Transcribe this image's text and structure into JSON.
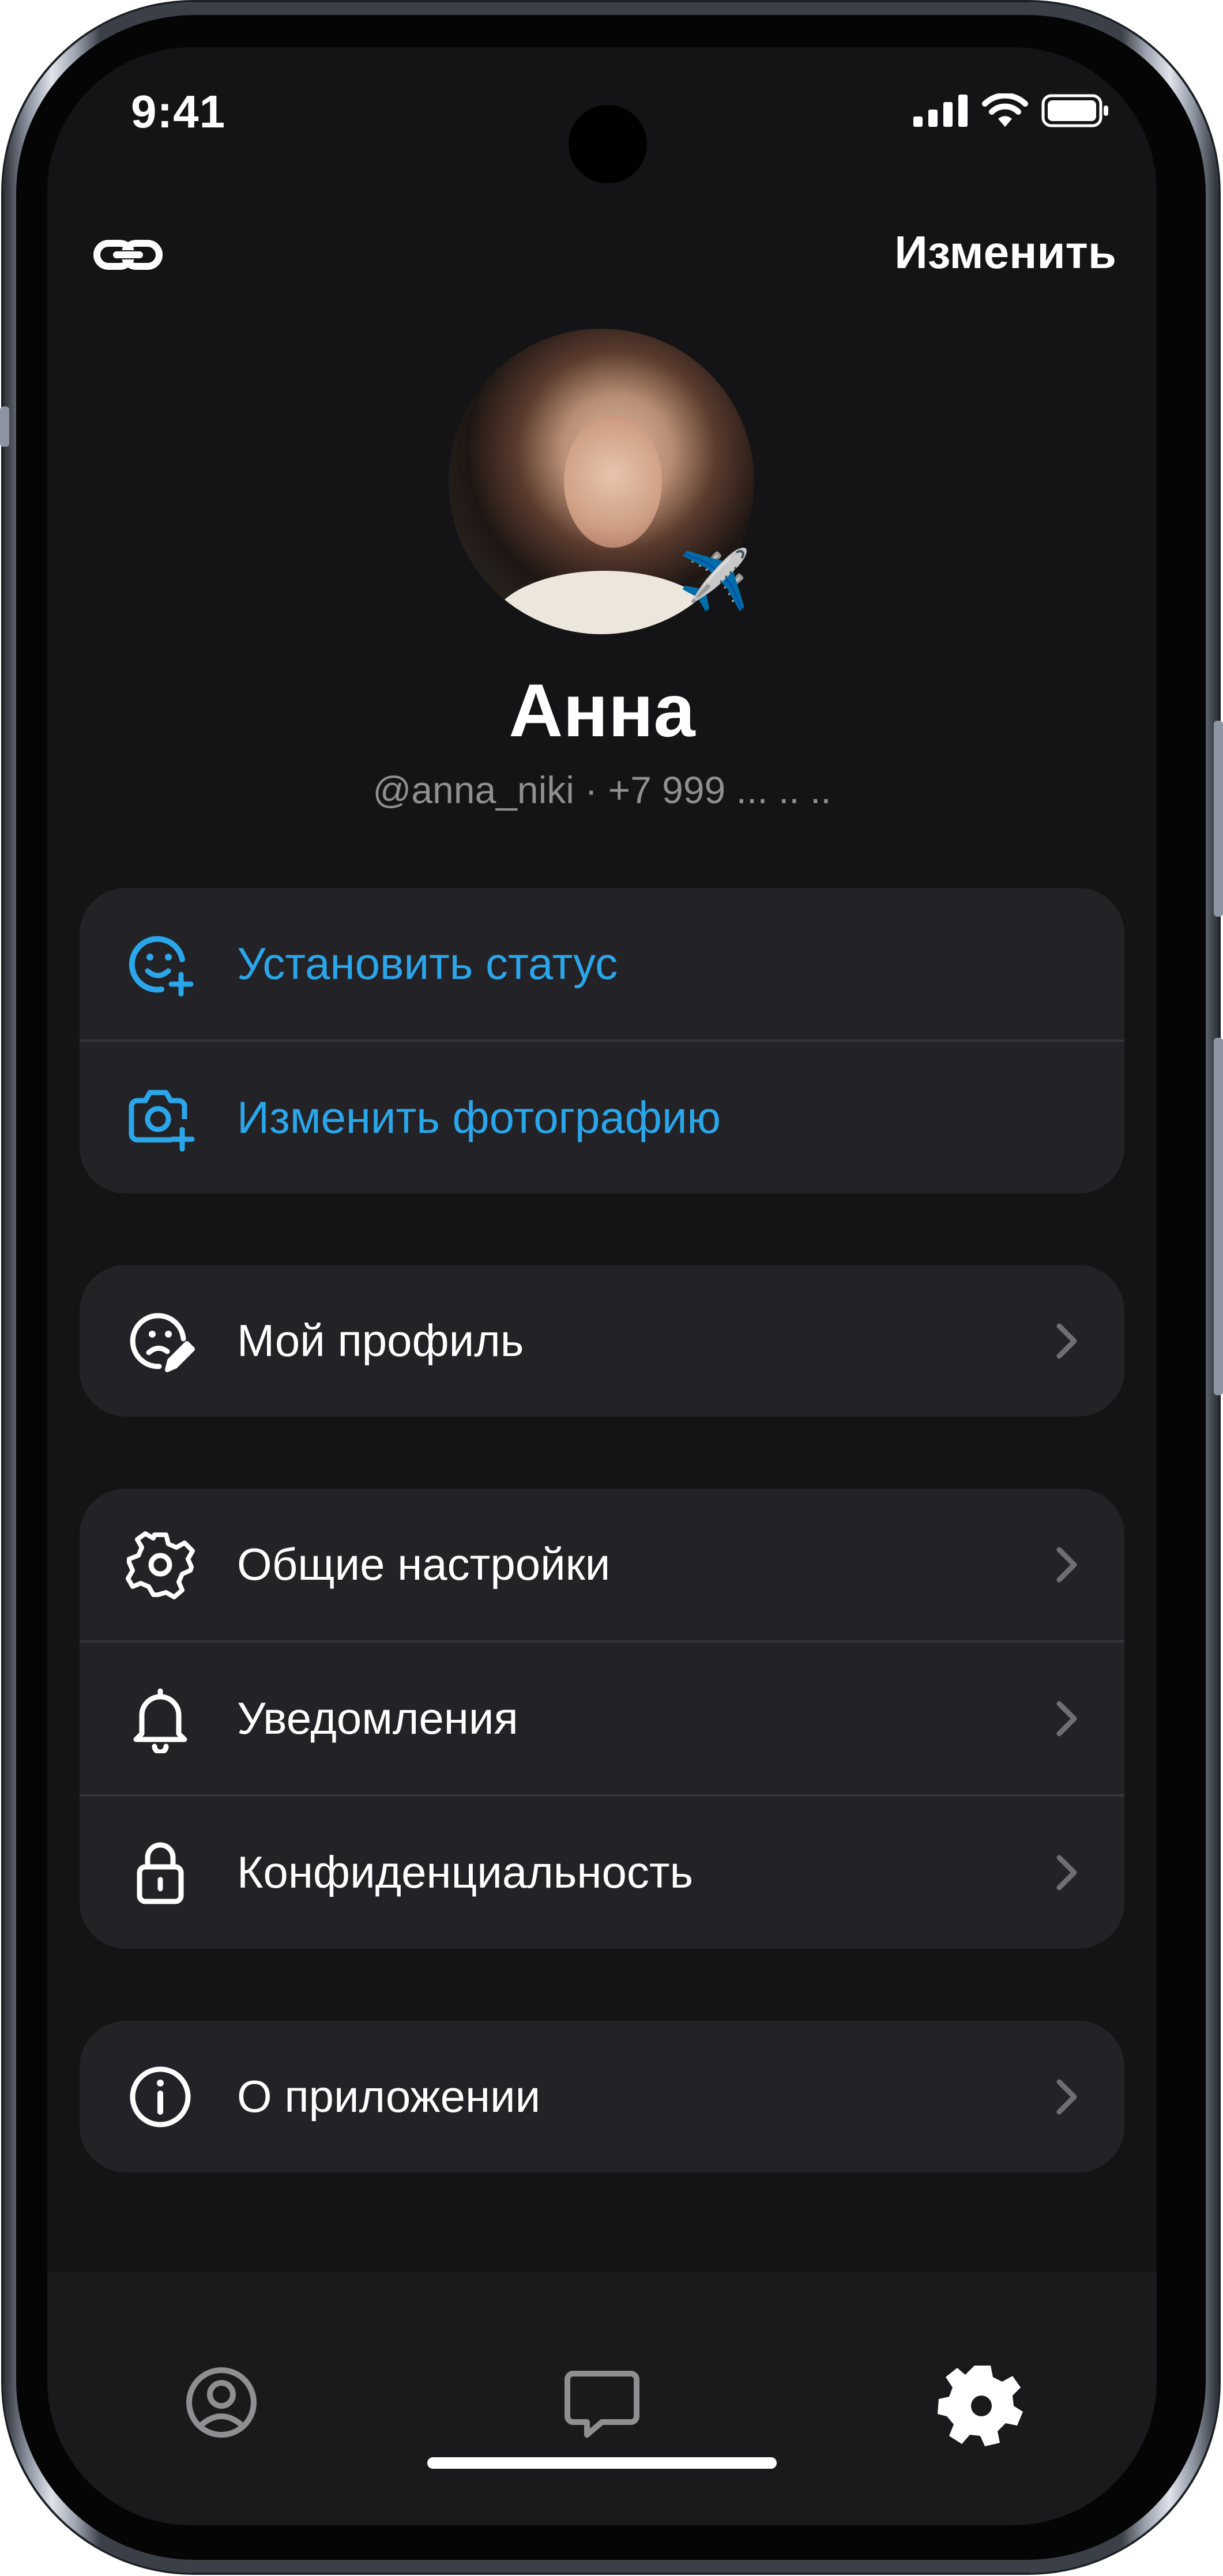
{
  "status_bar": {
    "time": "9:41"
  },
  "header": {
    "edit_label": "Изменить"
  },
  "profile": {
    "name": "Анна",
    "subtitle": "@anna_niki · +7 999 ... .. ..",
    "status_emoji": "✈️"
  },
  "quick_actions": [
    {
      "label": "Установить статус",
      "icon": "smiley-plus-icon"
    },
    {
      "label": "Изменить фотографию",
      "icon": "camera-plus-icon"
    }
  ],
  "profile_section": [
    {
      "label": "Мой профиль",
      "icon": "profile-edit-icon"
    }
  ],
  "settings_section": [
    {
      "label": "Общие настройки",
      "icon": "gear-icon"
    },
    {
      "label": "Уведомления",
      "icon": "bell-icon"
    },
    {
      "label": "Конфиденциальность",
      "icon": "lock-icon"
    }
  ],
  "about_section": [
    {
      "label": "О приложении",
      "icon": "info-icon"
    }
  ],
  "tab_bar": [
    {
      "icon": "user-circle-icon",
      "active": false
    },
    {
      "icon": "chat-bubble-icon",
      "active": false
    },
    {
      "icon": "gear-icon",
      "active": true
    }
  ],
  "colors": {
    "accent": "#2aa6ea",
    "background": "#141416",
    "card": "#232327",
    "secondary_text": "#8e8e93"
  }
}
